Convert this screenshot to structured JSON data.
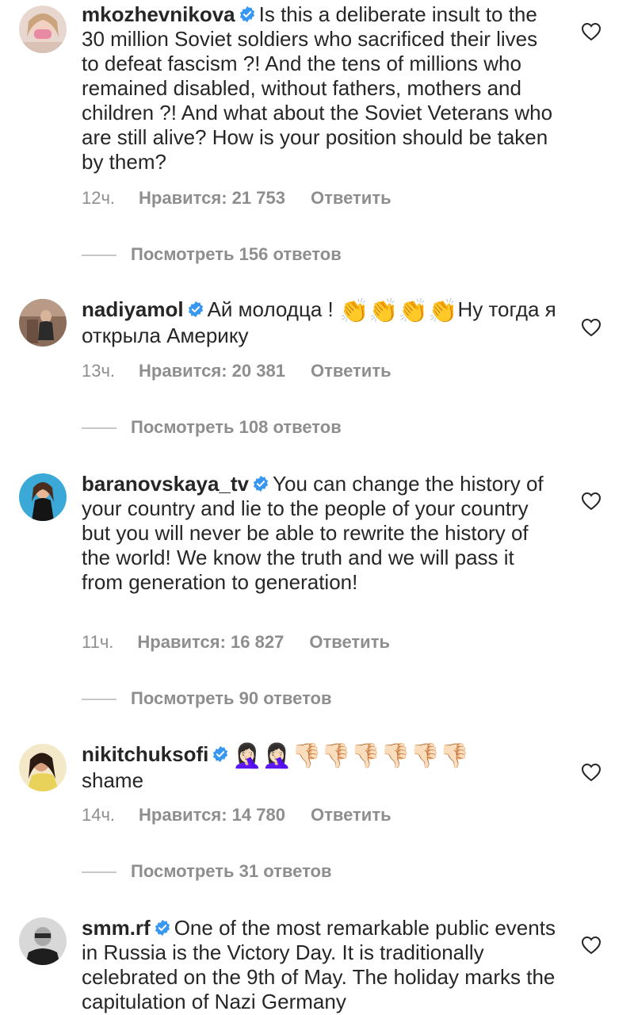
{
  "colors": {
    "text": "#262626",
    "meta": "#8e8e8e",
    "verified": "#3897f0",
    "reply_line": "#c7c7c7"
  },
  "icons": {
    "like": "heart-outline-icon",
    "verified": "verified-badge-icon"
  },
  "comments": [
    {
      "username": "mkozhevnikova",
      "verified": true,
      "text": "Is this a deliberate insult to the 30 million Soviet soldiers who sacrificed their lives to defeat fascism ?! And the tens of millions who remained disabled, without fathers, mothers and children ?! And what about the Soviet Veterans who are still alive? How is your position should be taken by them?",
      "time": "12ч.",
      "likes": "Нравится: 21 753",
      "reply": "Ответить",
      "view_replies": "Посмотреть 156 ответов"
    },
    {
      "username": "nadiyamol",
      "verified": true,
      "text_before": "Ай молодца !",
      "emoji": "👏👏👏👏",
      "text_after": "Ну тогда я открыла Америку",
      "time": "13ч.",
      "likes": "Нравится: 20 381",
      "reply": "Ответить",
      "view_replies": "Посмотреть 108 ответов"
    },
    {
      "username": "baranovskaya_tv",
      "verified": true,
      "text": "You can change the history of your country and lie to the people of your country but you will never be able to rewrite the history of the world! We know the truth and we will pass it from generation to generation!",
      "time": "11ч.",
      "likes": "Нравится: 16 827",
      "reply": "Ответить",
      "view_replies": "Посмотреть 90 ответов"
    },
    {
      "username": "nikitchuksofi",
      "verified": true,
      "emoji": "🤦🏻‍♀️🤦🏻‍♀️👎🏻👎🏻👎🏻👎🏻👎🏻👎🏻",
      "text": "shame",
      "time": "14ч.",
      "likes": "Нравится: 14 780",
      "reply": "Ответить",
      "view_replies": "Посмотреть 31 ответов"
    },
    {
      "username": "smm.rf",
      "verified": true,
      "text": "One of the most remarkable public events in Russia is the Victory Day. It is traditionally celebrated on the 9th of May. The holiday marks the capitulation of Nazi Germany"
    }
  ]
}
